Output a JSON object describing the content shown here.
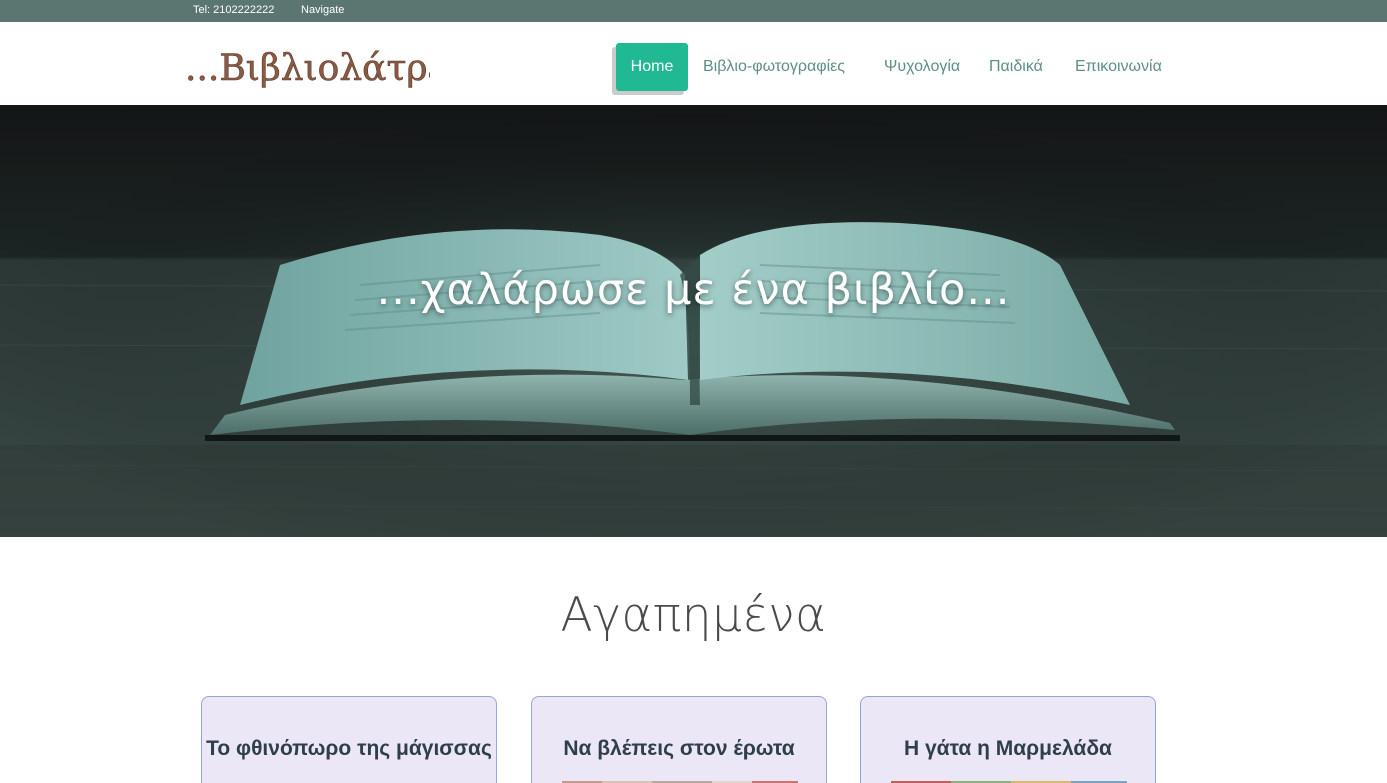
{
  "topbar": {
    "phone": "Tel: 2102222222",
    "navigate": "Navigate"
  },
  "header": {
    "logo_text": "...Βιβλιολάτρεις...",
    "menu": [
      {
        "label": "Home",
        "active": true
      },
      {
        "label": "Βιβλιο-φωτογραφίες",
        "active": false
      },
      {
        "label": "Ψυχολογία",
        "active": false
      },
      {
        "label": "Παιδικά",
        "active": false
      },
      {
        "label": "Επικοινωνία",
        "active": false
      }
    ]
  },
  "hero": {
    "title": "...χαλάρωσε με ένα βιβλίο..."
  },
  "favorites": {
    "title": "Αγαπημένα",
    "cards": [
      {
        "title": "Το φθινόπωρο της μάγισσας"
      },
      {
        "title": "Να βλέπεις στον έρωτα"
      },
      {
        "title": "Η γάτα η Μαρμελάδα"
      }
    ]
  },
  "colors": {
    "topbar": "#5b7570",
    "accent": "#21b994",
    "menu_text": "#5e8f86",
    "card_bg": "#ece7f6",
    "logo": "#8a5a44"
  }
}
